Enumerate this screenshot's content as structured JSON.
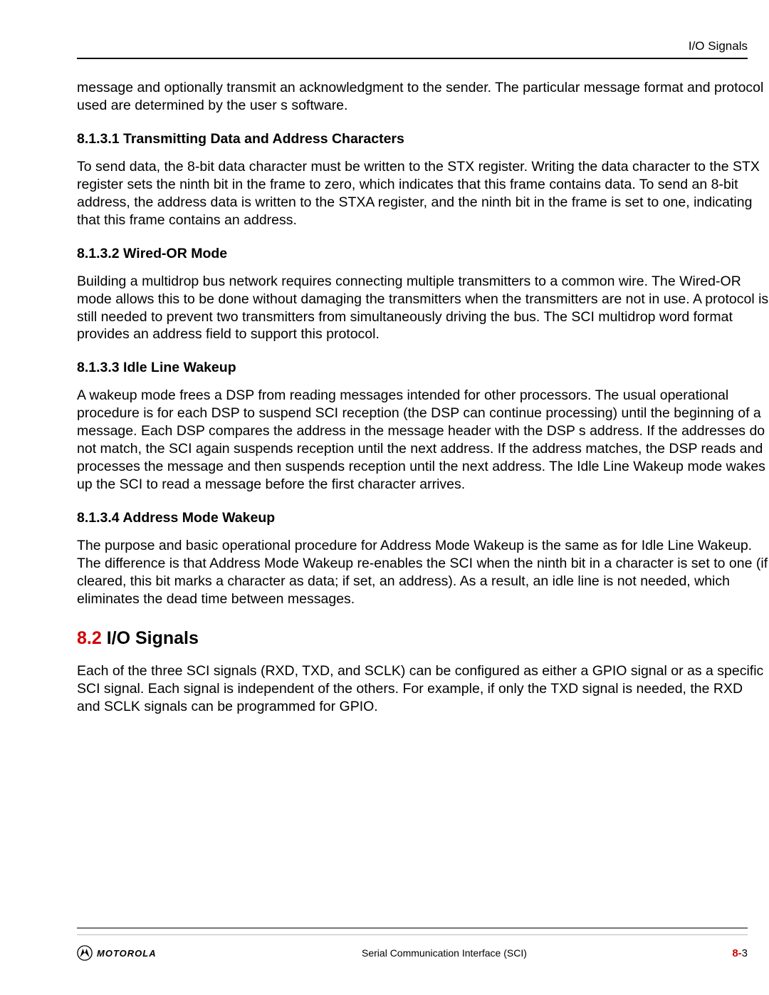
{
  "header": {
    "running_title": "I/O Signals"
  },
  "intro_continuation": "message and optionally transmit an acknowledgment to the sender. The particular message format and protocol used are determined by the user s software.",
  "s_8_1_3_1": {
    "heading": "8.1.3.1 Transmitting Data and Address Characters",
    "body": "To send data, the 8-bit data character must be written to the STX register. Writing the data character to the STX register sets the ninth bit in the frame to zero, which indicates that this frame contains data. To send an 8-bit address, the address data is written to the STXA register, and the ninth bit in the frame is set to one, indicating that this frame contains an address."
  },
  "s_8_1_3_2": {
    "heading": "8.1.3.2 Wired-OR Mode",
    "body": "Building a multidrop bus network requires connecting multiple transmitters to a common wire. The Wired-OR mode allows this to be done without damaging the transmitters when the transmitters are not in use. A protocol is still needed to prevent two transmitters from simultaneously driving the bus. The SCI multidrop word format provides an address field to support this protocol."
  },
  "s_8_1_3_3": {
    "heading": "8.1.3.3 Idle Line Wakeup",
    "body": "A wakeup mode frees a DSP from reading messages intended for other processors. The usual operational procedure is for each DSP to suspend SCI reception (the DSP can continue processing) until the beginning of a message. Each DSP compares the address in the message header with the DSP s address. If the addresses do not match, the SCI again suspends reception until the next address. If the address matches, the DSP reads and processes the message and then suspends reception until the next address. The Idle Line Wakeup mode wakes up the SCI to read a message before the first character arrives."
  },
  "s_8_1_3_4": {
    "heading": "8.1.3.4 Address Mode Wakeup",
    "body": "The purpose and basic operational procedure for Address Mode Wakeup is the same as for Idle Line Wakeup. The difference is that Address Mode Wakeup re-enables the SCI when the ninth bit in a character is set to one (if cleared, this bit marks a character as data; if set, an address). As a result, an idle line is not needed, which eliminates the dead time between messages."
  },
  "s_8_2": {
    "num": "8.2",
    "title": " I/O Signals",
    "body_part1": "Each of the three SCI signals (",
    "sig1": "RXD",
    "body_part2": ", ",
    "sig2": "TXD",
    "body_part3": ", and ",
    "sig3": "SCLK",
    "body_part4": ") can be configured as either a GPIO signal or as a specific SCI signal. Each signal is independent of the others. For example, if only the ",
    "sig4": "TXD",
    "body_part5": " signal is needed, the ",
    "sig5": "RXD",
    "body_part6": " and ",
    "sig6": "SCLK",
    "body_part7": " signals can be programmed for GPIO."
  },
  "footer": {
    "logo_text": "MOTOROLA",
    "center": "Serial Communication Interface (SCI)",
    "page_chapter": "8-",
    "page_num": "3"
  }
}
